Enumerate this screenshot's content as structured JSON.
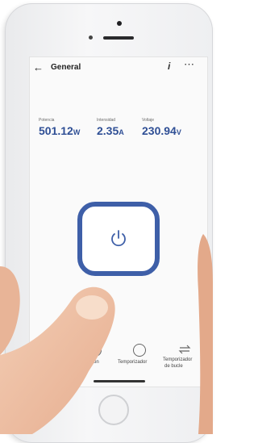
{
  "header": {
    "back_icon": "arrow-left-icon",
    "title": "General",
    "info_icon": "info-icon",
    "more_icon": "more-icon"
  },
  "metrics": [
    {
      "label": "Potencia",
      "value": "501.12",
      "unit": "W"
    },
    {
      "label": "Intensidad",
      "value": "2.35",
      "unit": "A"
    },
    {
      "label": "Voltaje",
      "value": "230.94",
      "unit": "V"
    }
  ],
  "power_button": {
    "icon": "power-icon"
  },
  "bottom_nav": {
    "items": [
      {
        "label": "Programación",
        "visible": "ramación",
        "icon": "clock-icon"
      },
      {
        "label": "Temporizador",
        "icon": "timer-icon"
      },
      {
        "label": "Temporizador de bucle",
        "line1": "Temporizador",
        "line2": "de bucle",
        "icon": "loop-icon"
      }
    ]
  },
  "colors": {
    "accent": "#3e5fa8",
    "value_text": "#2f4f95",
    "badge": "#c0272d"
  }
}
